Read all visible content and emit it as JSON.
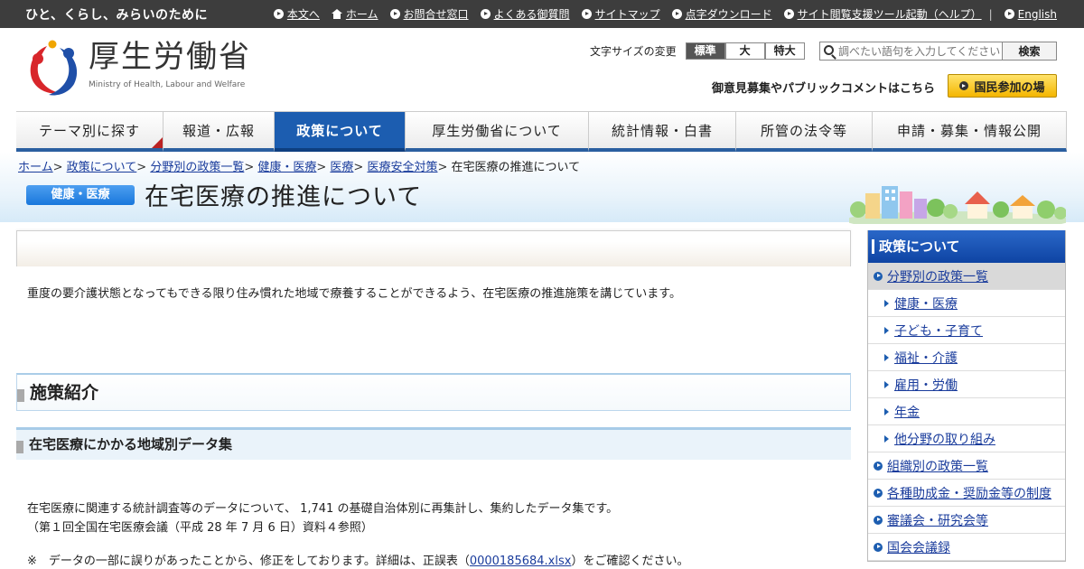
{
  "topbar": {
    "tagline": "ひと、くらし、みらいのために",
    "links": [
      {
        "label": "本文へ",
        "icon": "arrow-circle-icon"
      },
      {
        "label": "ホーム",
        "icon": "home-icon"
      },
      {
        "label": "お問合せ窓口",
        "icon": "arrow-circle-icon"
      },
      {
        "label": "よくある御質問",
        "icon": "arrow-circle-icon"
      },
      {
        "label": "サイトマップ",
        "icon": "arrow-circle-icon"
      },
      {
        "label": "点字ダウンロード",
        "icon": "arrow-circle-icon"
      },
      {
        "label": "サイト閲覧支援ツール起動（ヘルプ）",
        "icon": "arrow-circle-icon"
      }
    ],
    "english": "English"
  },
  "header": {
    "logo_jp": "厚生労働省",
    "logo_en": "Ministry of Health, Labour and Welfare",
    "fontsize_label": "文字サイズの変更",
    "fontsize_options": [
      "標準",
      "大",
      "特大"
    ],
    "search_placeholder": "調べたい語句を入力してください",
    "search_button": "検索",
    "pubcomment": "御意見募集やパブリックコメントはこちら",
    "participate": "国民参加の場"
  },
  "nav": [
    {
      "label": "テーマ別に探す",
      "w": 163
    },
    {
      "label": "報道・広報",
      "w": 123
    },
    {
      "label": "政策について",
      "w": 145,
      "active": true
    },
    {
      "label": "厚生労働省について",
      "w": 203
    },
    {
      "label": "統計情報・白書",
      "w": 163
    },
    {
      "label": "所管の法令等",
      "w": 151
    },
    {
      "label": "申請・募集・情報公開",
      "w": 215
    }
  ],
  "breadcrumb": {
    "links": [
      "ホーム",
      "政策について",
      "分野別の政策一覧",
      "健康・医療",
      "医療",
      "医療安全対策"
    ],
    "current": "在宅医療の推進について"
  },
  "page": {
    "category": "健康・医療",
    "title": "在宅医療の推進について",
    "intro": "重度の要介護状態となってもできる限り住み慣れた地域で療養することができるよう、在宅医療の推進施策を講じています。",
    "section_title": "施策紹介",
    "subsection_title": "在宅医療にかかる地域別データ集",
    "body_line1": "在宅医療に関連する統計調査等のデータについて、 1,741 の基礎自治体別に再集計し、集約したデータ集です。",
    "body_line2": "（第１回全国在宅医療会議（平成 28 年 7 月 6 日）資料４参照）",
    "note_prefix": "※　データの一部に誤りがあったことから、修正をしております。詳細は、正誤表（",
    "note_link": "0000185684.xlsx",
    "note_suffix": "）をご確認ください。"
  },
  "sidebar": {
    "heading": "政策について",
    "items": [
      {
        "label": "分野別の政策一覧",
        "type": "current"
      },
      {
        "label": "健康・医療",
        "type": "sub"
      },
      {
        "label": "子ども・子育て",
        "type": "sub"
      },
      {
        "label": "福祉・介護",
        "type": "sub"
      },
      {
        "label": "雇用・労働",
        "type": "sub"
      },
      {
        "label": "年金",
        "type": "sub"
      },
      {
        "label": "他分野の取り組み",
        "type": "sub"
      },
      {
        "label": "組織別の政策一覧",
        "type": "top"
      },
      {
        "label": "各種助成金・奨励金等の制度",
        "type": "top"
      },
      {
        "label": "審議会・研究会等",
        "type": "top"
      },
      {
        "label": "国会会議録",
        "type": "top"
      }
    ]
  },
  "colors": {
    "topbar": "#3d3d3d",
    "nav_active": "#1c5db0",
    "link": "#1a3c9c",
    "participate": "#f4b600"
  }
}
